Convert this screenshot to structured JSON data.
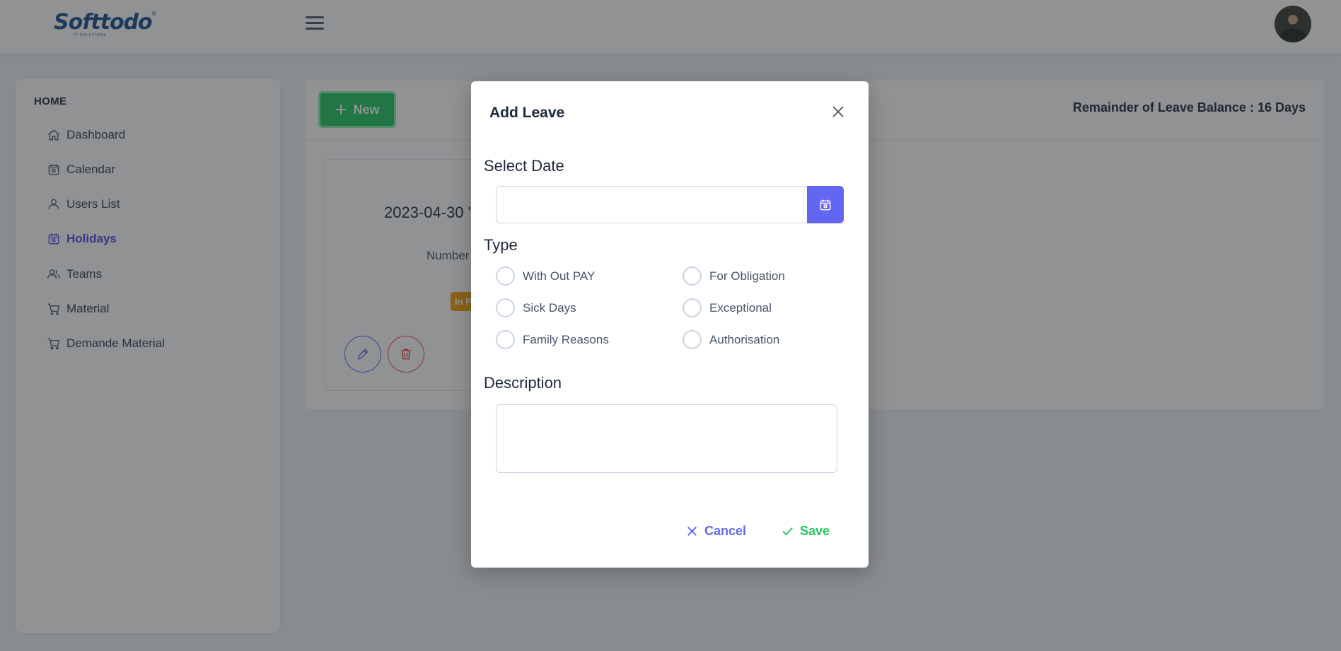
{
  "app": {
    "logo_text": "Softtodo",
    "logo_reg": "®",
    "logo_subtitle": "IT SOLUTIONS"
  },
  "sidebar": {
    "heading": "HOME",
    "items": [
      {
        "label": "Dashboard",
        "icon": "home-icon"
      },
      {
        "label": "Calendar",
        "icon": "calendar-icon"
      },
      {
        "label": "Users List",
        "icon": "user-icon"
      },
      {
        "label": "Holidays",
        "icon": "calendar-icon",
        "active": true
      },
      {
        "label": "Teams",
        "icon": "users-icon"
      },
      {
        "label": "Material",
        "icon": "cart-icon"
      },
      {
        "label": "Demande Material",
        "icon": "cart-icon"
      }
    ]
  },
  "main": {
    "new_button_label": "New",
    "balance_text": "Remainder of Leave Balance : 16 Days",
    "card": {
      "date": "2023-04-30 '",
      "number_label": "Number",
      "status": "In P"
    }
  },
  "modal": {
    "title": "Add Leave",
    "select_date_label": "Select Date",
    "date_value": "",
    "type_label": "Type",
    "types": [
      "With Out PAY",
      "For Obligation",
      "Sick Days",
      "Exceptional",
      "Family Reasons",
      "Authorisation"
    ],
    "description_label": "Description",
    "description_value": "",
    "cancel_label": "Cancel",
    "save_label": "Save"
  },
  "colors": {
    "accent": "#6366f1",
    "success": "#22c55e",
    "warning": "#f59e0b",
    "danger": "#ef4444"
  }
}
